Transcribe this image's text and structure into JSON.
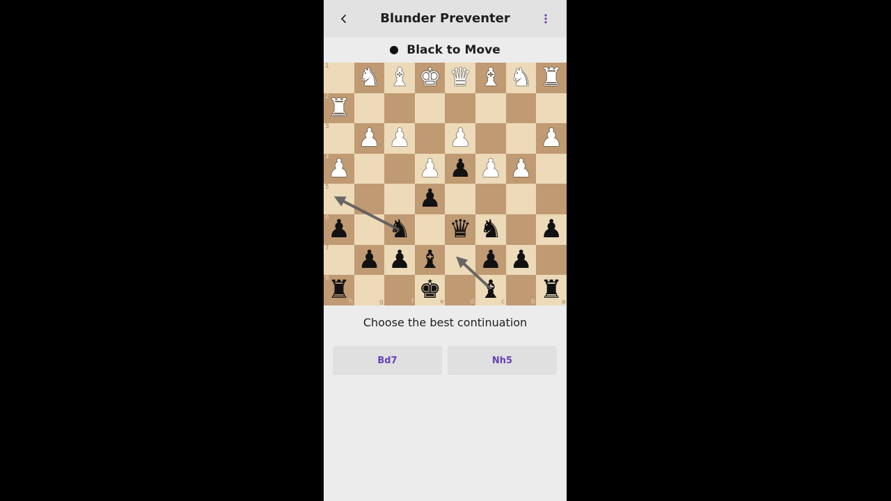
{
  "app": {
    "title": "Blunder Preventer"
  },
  "turn": {
    "text": "Black to Move"
  },
  "board": {
    "ranks": [
      "1",
      "2",
      "3",
      "4",
      "5",
      "6",
      "7",
      "8"
    ],
    "files": [
      "h",
      "g",
      "f",
      "e",
      "d",
      "c",
      "b",
      "a"
    ],
    "rows": [
      [
        null,
        "N",
        "B",
        "K",
        "Q",
        "B",
        "N",
        "R"
      ],
      [
        "R",
        null,
        null,
        null,
        null,
        null,
        null,
        null
      ],
      [
        null,
        "P",
        "P",
        null,
        "P",
        null,
        null,
        "P"
      ],
      [
        "P",
        null,
        null,
        "P",
        "p",
        "P",
        "P",
        null
      ],
      [
        null,
        null,
        null,
        "p",
        null,
        null,
        null,
        null
      ],
      [
        "p",
        null,
        "n",
        null,
        "q",
        "n",
        null,
        "p"
      ],
      [
        null,
        "p",
        "p",
        "b",
        null,
        "p",
        "p",
        null
      ],
      [
        "r",
        null,
        null,
        "k",
        null,
        "b",
        null,
        "r"
      ]
    ],
    "arrow_color": "#5a5a5a"
  },
  "prompt": "Choose the best continuation",
  "choices": [
    "Bd7",
    "Nh5"
  ],
  "colors": {
    "light_square": "#ecdab9",
    "dark_square": "#c09a72",
    "accent": "#6a3fb5"
  }
}
